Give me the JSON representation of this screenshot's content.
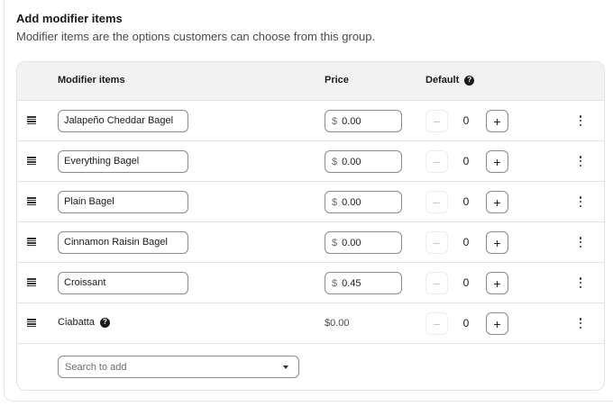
{
  "section": {
    "title": "Add modifier items",
    "subtitle": "Modifier items are the options customers can choose from this group."
  },
  "table": {
    "headers": {
      "items": "Modifier items",
      "price": "Price",
      "default": "Default"
    },
    "rows": [
      {
        "name": "Jalapeño Cheddar Bagel",
        "editable": true,
        "currency": "$",
        "price": "0.00",
        "default_count": "0"
      },
      {
        "name": "Everything Bagel",
        "editable": true,
        "currency": "$",
        "price": "0.00",
        "default_count": "0"
      },
      {
        "name": "Plain Bagel",
        "editable": true,
        "currency": "$",
        "price": "0.00",
        "default_count": "0"
      },
      {
        "name": "Cinnamon Raisin Bagel",
        "editable": true,
        "currency": "$",
        "price": "0.00",
        "default_count": "0"
      },
      {
        "name": "Croissant",
        "editable": true,
        "currency": "$",
        "price": "0.45",
        "default_count": "0"
      },
      {
        "name": "Ciabatta",
        "editable": false,
        "price_text": "$0.00",
        "default_count": "0"
      }
    ],
    "stepper": {
      "minus": "−",
      "plus": "+"
    },
    "help_glyph": "?"
  },
  "search": {
    "placeholder": "Search to add"
  },
  "icons": {
    "drag": "drag-handle-icon",
    "more": "more-vertical-icon",
    "help": "question-circle-icon",
    "caret": "caret-down-icon"
  }
}
